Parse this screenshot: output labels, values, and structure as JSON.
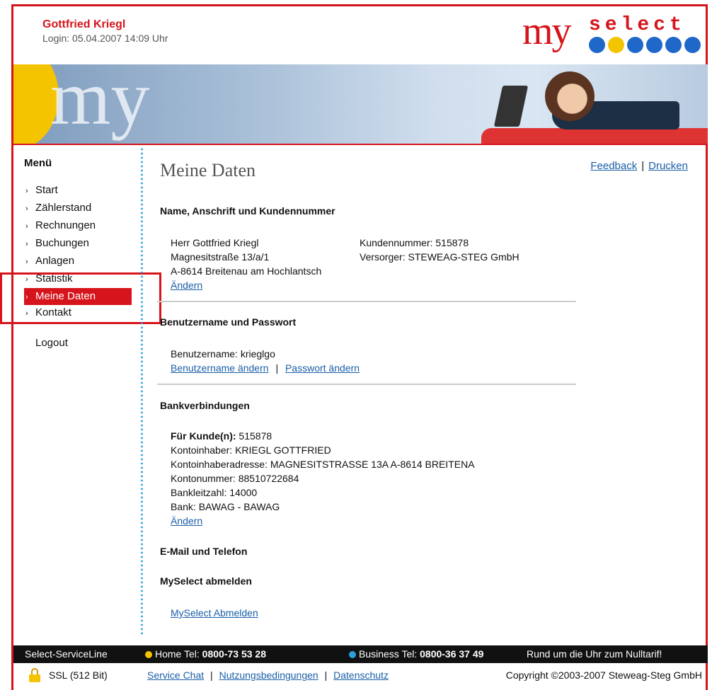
{
  "header": {
    "user_name": "Gottfried Kriegl",
    "login_info": "Login: 05.04.2007 14:09 Uhr",
    "logo_my": "my",
    "logo_select": "select"
  },
  "banner": {
    "text": "my"
  },
  "sidebar": {
    "title": "Menü",
    "items": [
      {
        "label": "Start"
      },
      {
        "label": "Zählerstand"
      },
      {
        "label": "Rechnungen"
      },
      {
        "label": "Buchungen"
      },
      {
        "label": "Anlagen"
      },
      {
        "label": "Statistik"
      },
      {
        "label": "Meine Daten"
      },
      {
        "label": "Kontakt"
      }
    ],
    "active_item": "Meine Daten",
    "logout": "Logout"
  },
  "main": {
    "title": "Meine Daten",
    "feedback": "Feedback",
    "drucken": "Drucken",
    "link_separator": "|",
    "section1": {
      "heading": "Name, Anschrift und Kundennummer",
      "name": "Herr Gottfried Kriegl",
      "street": "Magnesitstraße 13/a/1",
      "city": "A-8614 Breitenau am Hochlantsch",
      "customer_number": "Kundennummer: 515878",
      "supplier": "Versorger: STEWEAG-STEG GmbH",
      "edit": "Ändern"
    },
    "section2": {
      "heading": "Benutzername und Passwort",
      "username": "Benutzername:  krieglgo",
      "change_username": "Benutzername ändern",
      "change_password": "Passwort ändern"
    },
    "section3": {
      "heading": "Bankverbindungen",
      "customer_label": "Für Kunde(n):",
      "customer_value": " 515878",
      "account_holder": "Kontoinhaber: KRIEGL GOTTFRIED",
      "holder_address": "Kontoinhaberadresse: MAGNESITSTRASSE 13A A-8614 BREITENA",
      "account_number": "Kontonummer: 88510722684",
      "bank_code": "Bankleitzahl: 14000",
      "bank": "Bank: BAWAG - BAWAG",
      "edit": "Ändern"
    },
    "section4": {
      "heading": "E-Mail und Telefon"
    },
    "section5": {
      "heading": "MySelect abmelden",
      "link": "MySelect Abmelden"
    }
  },
  "footer": {
    "service_line": "Select-ServiceLine",
    "home_label": "Home Tel: ",
    "home_tel": "0800-73 53 28",
    "business_label": "Business Tel: ",
    "business_tel": "0800-36 37 49",
    "slogan": "Rund um die Uhr zum Nulltarif!",
    "ssl": "SSL (512 Bit)",
    "service_chat": "Service Chat",
    "terms": "Nutzungsbedingungen",
    "privacy": "Datenschutz",
    "copyright": "Copyright ©2003-2007 Steweag-Steg GmbH"
  },
  "colors": {
    "brand_red": "#d6141b",
    "link_blue": "#1a5fa8",
    "accent_yellow": "#f5c400",
    "accent_blue": "#1f67c9"
  }
}
